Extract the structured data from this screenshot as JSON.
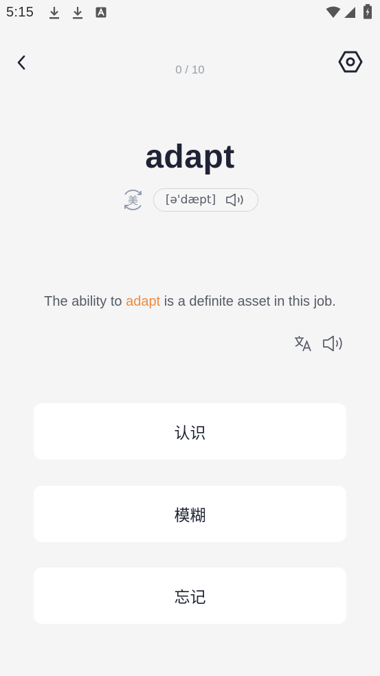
{
  "status_bar": {
    "time": "5:15",
    "icons": [
      "download-icon",
      "download-icon",
      "text-app-icon",
      "wifi-icon",
      "signal-icon",
      "battery-charging-icon"
    ]
  },
  "header": {
    "progress": "0 / 10",
    "back_icon": "chevron-left-icon",
    "settings_icon": "hexagon-settings-icon"
  },
  "word": {
    "text": "adapt",
    "accent_label": "美",
    "phonetic": "[ə'dæpt]"
  },
  "sentence": {
    "before": "The ability to ",
    "highlight": "adapt",
    "after": " is a definite asset in this job.",
    "highlight_color": "#f08a3a"
  },
  "answers": {
    "know": "认识",
    "vague": "模糊",
    "forget": "忘记"
  },
  "colors": {
    "background": "#f5f5f5",
    "button": "#ffffff",
    "primary_text": "#1f2335",
    "muted_text": "#9aa0aa",
    "accent": "#f08a3a"
  }
}
